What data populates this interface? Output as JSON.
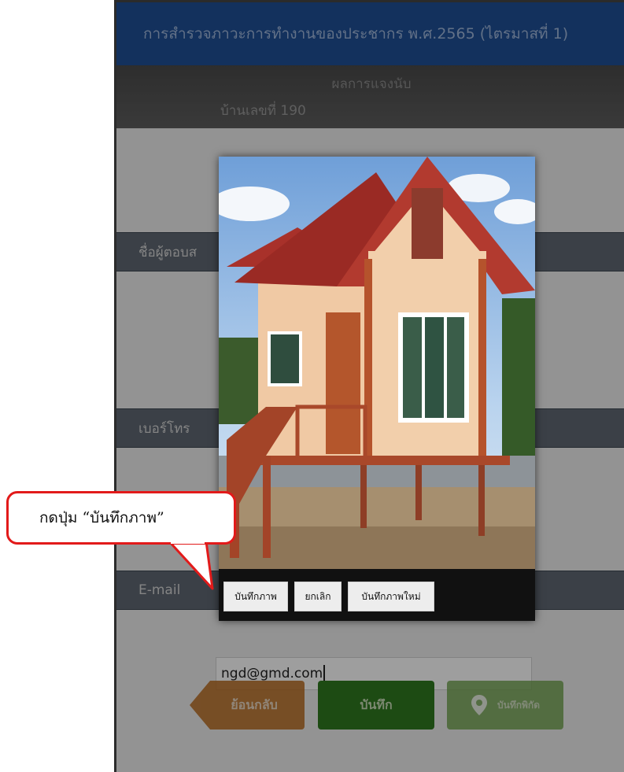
{
  "app": {
    "title": "การสำรวจภาวะการทำงานของประชากร พ.ศ.2565 (ไตรมาสที่ 1)"
  },
  "header": {
    "section_title": "ผลการแจงนับ",
    "house_number": "บ้านเลขที่ 190"
  },
  "form": {
    "respondent_label": "ชื่อผู้ตอบส",
    "phone_label": "เบอร์โทร",
    "email_label": "E-mail",
    "email_value": "ngd@gmd.com"
  },
  "buttons": {
    "back": "ย้อนกลับ",
    "save": "บันทึก",
    "save_location": "บันทึกพิกัด"
  },
  "photo_dialog": {
    "save_photo": "บันทึกภาพ",
    "cancel": "ยกเลิก",
    "retake_photo": "บันทึกภาพใหม่"
  },
  "annotation": {
    "callout_text": "กดปุ่ม “บันทึกภาพ”",
    "color": "#e21a1a"
  },
  "colors": {
    "titlebar": "#1f4f97",
    "section_bar": "#5f6873",
    "back_button": "#b86a1e",
    "save_button": "#2f7a1f",
    "location_button": "#6da14a"
  }
}
